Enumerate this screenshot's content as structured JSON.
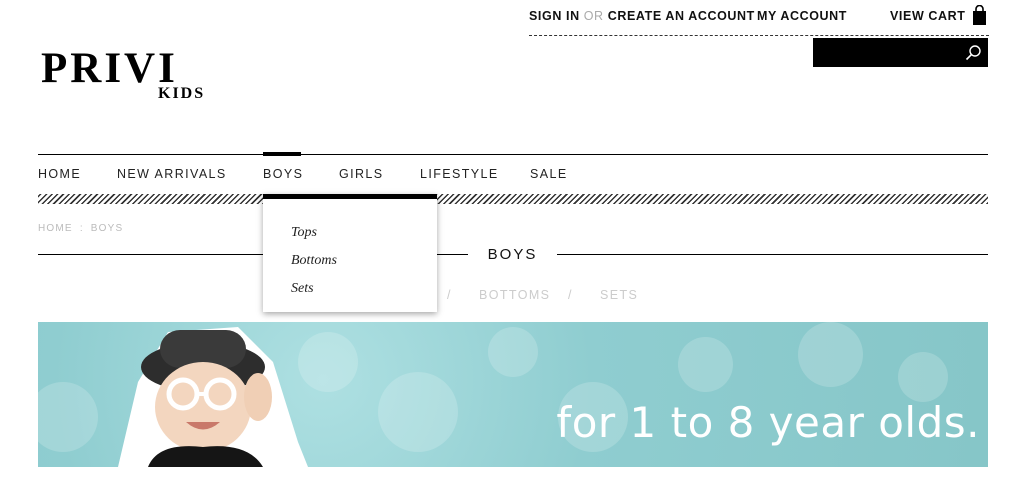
{
  "header": {
    "sign_in": "SIGN IN",
    "or": "OR",
    "create_account": "CREATE AN ACCOUNT",
    "my_account": "MY ACCOUNT",
    "view_cart": "VIEW CART",
    "search_placeholder": ""
  },
  "logo": {
    "brand": "PRIVI",
    "sub": "KIDS"
  },
  "nav": {
    "items": [
      {
        "label": "HOME"
      },
      {
        "label": "NEW ARRIVALS"
      },
      {
        "label": "BOYS"
      },
      {
        "label": "GIRLS"
      },
      {
        "label": "LIFESTYLE"
      },
      {
        "label": "SALE"
      }
    ],
    "active": "BOYS"
  },
  "dropdown": {
    "items": [
      "Tops",
      "Bottoms",
      "Sets"
    ]
  },
  "breadcrumb": {
    "home": "HOME",
    "sep": ":",
    "current": "BOYS"
  },
  "page": {
    "title": "BOYS"
  },
  "subnav": {
    "sep1": "/",
    "bottoms": "BOTTOMS",
    "sep2": "/",
    "sets": "SETS"
  },
  "banner": {
    "text": "for 1 to 8 year olds."
  },
  "colors": {
    "banner_bg": "#8fcdd0",
    "text_dark": "#111111",
    "muted": "#cccccc"
  }
}
